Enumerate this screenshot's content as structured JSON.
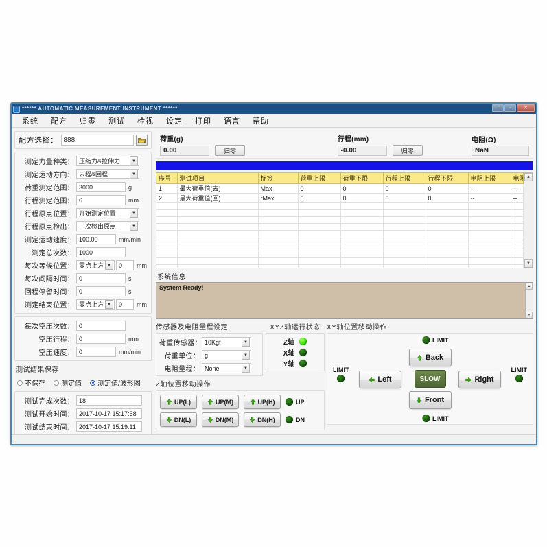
{
  "window": {
    "title": "****** AUTOMATIC MEASUREMENT INSTRUMENT ******",
    "minimize": "—",
    "maximize": "▫",
    "close": "✕"
  },
  "menubar": {
    "items": [
      {
        "label": "系统"
      },
      {
        "label": "配方"
      },
      {
        "label": "归零"
      },
      {
        "label": "测试"
      },
      {
        "label": "检视"
      },
      {
        "label": "设定"
      },
      {
        "label": "打印"
      },
      {
        "label": "语言"
      },
      {
        "label": "帮助"
      }
    ]
  },
  "recipe": {
    "label": "配方选择：",
    "value": "888",
    "placeholder": "",
    "browse_icon": "folder-open-icon"
  },
  "measure_params": {
    "rows": [
      {
        "label": "测定力量种类：",
        "value": "压缩力&拉伸力",
        "type": "combo",
        "unit": ""
      },
      {
        "label": "测定运动方向：",
        "value": "去程&回程",
        "type": "combo",
        "unit": ""
      },
      {
        "label": "荷重测定范围：",
        "value": "3000",
        "type": "input",
        "unit": "g"
      },
      {
        "label": "行程测定范围：",
        "value": "6",
        "type": "input",
        "unit": "mm"
      },
      {
        "label": "行程原点位置：",
        "value": "开始测定位置",
        "type": "combo",
        "unit": ""
      },
      {
        "label": "行程原点检出：",
        "value": "一次检出原点",
        "type": "combo",
        "unit": ""
      },
      {
        "label": "测定运动速度：",
        "value": "100.00",
        "type": "input",
        "unit": "mm/min"
      },
      {
        "label": "测定总次数：",
        "value": "1000",
        "type": "input",
        "unit": ""
      },
      {
        "label": "每次等候位置：",
        "value": "零点上方",
        "type": "combo-input",
        "value2": "0",
        "unit": "mm"
      },
      {
        "label": "每次间隔时间：",
        "value": "0",
        "type": "input",
        "unit": "s"
      },
      {
        "label": "回程停留时间：",
        "value": "0",
        "type": "input",
        "unit": "s"
      },
      {
        "label": "测定结束位置：",
        "value": "零点上方",
        "type": "combo-input",
        "value2": "0",
        "unit": "mm"
      }
    ]
  },
  "preload_params": {
    "rows": [
      {
        "label": "每次空压次数：",
        "value": "0",
        "unit": ""
      },
      {
        "label": "空压行程：",
        "value": "0",
        "unit": "mm"
      },
      {
        "label": "空压速度：",
        "value": "0",
        "unit": "mm/min"
      }
    ]
  },
  "save_options": {
    "title": "测试结果保存",
    "options": [
      {
        "label": "不保存",
        "selected": false
      },
      {
        "label": "测定值",
        "selected": false
      },
      {
        "label": "测定值/波形图",
        "selected": true
      }
    ]
  },
  "test_status": {
    "rows": [
      {
        "label": "测试完成次数：",
        "value": "18"
      },
      {
        "label": "测试开始时间：",
        "value": "2017-10-17 15:17:58"
      },
      {
        "label": "测试结束时间：",
        "value": "2017-10-17 15:19:11"
      }
    ]
  },
  "readouts": {
    "load": {
      "caption": "荷重(g)",
      "value": "0.00",
      "button": "归零"
    },
    "stroke": {
      "caption": "行程(mm)",
      "value": "-0.00",
      "button": "归零"
    },
    "resistance": {
      "caption": "电阻(Ω)",
      "value": "NaN"
    }
  },
  "table": {
    "headers": [
      "序号",
      "测试项目",
      "标签",
      "荷重上限",
      "荷重下限",
      "行程上限",
      "行程下限",
      "电阻上限",
      "电阻下限"
    ],
    "rows": [
      [
        "1",
        "最大荷重值(去)",
        "Max",
        "0",
        "0",
        "0",
        "0",
        "--",
        "--"
      ],
      [
        "2",
        "最大荷重值(回)",
        "rMax",
        "0",
        "0",
        "0",
        "0",
        "--",
        "--"
      ],
      [
        "",
        "",
        "",
        "",
        "",
        "",
        "",
        "",
        ""
      ],
      [
        "",
        "",
        "",
        "",
        "",
        "",
        "",
        "",
        ""
      ],
      [
        "",
        "",
        "",
        "",
        "",
        "",
        "",
        "",
        ""
      ],
      [
        "",
        "",
        "",
        "",
        "",
        "",
        "",
        "",
        ""
      ],
      [
        "",
        "",
        "",
        "",
        "",
        "",
        "",
        "",
        ""
      ],
      [
        "",
        "",
        "",
        "",
        "",
        "",
        "",
        "",
        ""
      ],
      [
        "",
        "",
        "",
        "",
        "",
        "",
        "",
        "",
        ""
      ],
      [
        "",
        "",
        "",
        "",
        "",
        "",
        "",
        "",
        ""
      ],
      [
        "",
        "",
        "",
        "",
        "",
        "",
        "",
        "",
        ""
      ],
      [
        "",
        "",
        "",
        "",
        "",
        "",
        "",
        "",
        ""
      ],
      [
        "",
        "",
        "",
        "",
        "",
        "",
        "",
        "",
        ""
      ]
    ],
    "scroll_up": "▲",
    "scroll_down": "▼"
  },
  "system_info": {
    "label": "系统信息",
    "text": "System Ready!",
    "scroll_up": "▲",
    "scroll_down": "▼"
  },
  "sensor": {
    "title": "传感器及电阻量程设定",
    "rows": [
      {
        "label": "荷重传感器：",
        "value": "10Kgf"
      },
      {
        "label": "荷重单位：",
        "value": "g"
      },
      {
        "label": "电阻量程：",
        "value": "None"
      }
    ]
  },
  "axis_status": {
    "title": "XYZ轴运行状态",
    "items": [
      {
        "label": "Z轴",
        "state": "on"
      },
      {
        "label": "X轴",
        "state": "off"
      },
      {
        "label": "Y轴",
        "state": "off"
      }
    ]
  },
  "z_move": {
    "title": "Z轴位置移动操作",
    "up_buttons": [
      {
        "label": "UP(L)",
        "icon": "arrow-up-icon"
      },
      {
        "label": "UP(M)",
        "icon": "arrow-up-icon"
      },
      {
        "label": "UP(H)",
        "icon": "arrow-up-icon"
      }
    ],
    "down_buttons": [
      {
        "label": "DN(L)",
        "icon": "arrow-down-icon"
      },
      {
        "label": "DN(M)",
        "icon": "arrow-down-icon"
      },
      {
        "label": "DN(H)",
        "icon": "arrow-down-icon"
      }
    ],
    "up_led": {
      "label": "UP",
      "state": "off"
    },
    "down_led": {
      "label": "DN",
      "state": "off"
    }
  },
  "xy_move": {
    "title": "XY轴位置移动操作",
    "back": {
      "label": "Back",
      "icon": "arrow-up-icon"
    },
    "front": {
      "label": "Front",
      "icon": "arrow-down-icon"
    },
    "left": {
      "label": "Left",
      "icon": "arrow-left-icon"
    },
    "right": {
      "label": "Right",
      "icon": "arrow-right-icon"
    },
    "speed": {
      "label": "SLOW"
    },
    "limits": {
      "top": {
        "label": "LIMIT",
        "state": "off"
      },
      "bottom": {
        "label": "LIMIT",
        "state": "off"
      },
      "left": {
        "label": "LIMIT",
        "state": "off"
      },
      "right": {
        "label": "LIMIT",
        "state": "off"
      }
    }
  },
  "colors": {
    "titlebar": "#1d4e84",
    "frame": "#4a87b4",
    "blue_bar": "#1414e6",
    "table_header": "#fbea8a",
    "sysinfo_bg": "#cfbfa8",
    "led_on": "#33ee00",
    "led_off": "#1a5c10",
    "slow_button": "#4e6634"
  }
}
